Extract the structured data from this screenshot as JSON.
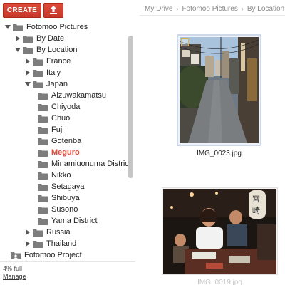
{
  "toolbar": {
    "create_label": "CREATE",
    "upload_icon": "upload-icon",
    "accent": "#dd4b39"
  },
  "breadcrumb": [
    "My Drive",
    "Fotomoo Pictures",
    "By Location"
  ],
  "tree": {
    "root": "Fotomoo Pictures",
    "by_date": "By Date",
    "by_location": "By Location",
    "countries": [
      "France",
      "Italy",
      "Japan"
    ],
    "japan_places": [
      "Aizuwakamatsu",
      "Chiyoda",
      "Chuo",
      "Fuji",
      "Gotenba",
      "Meguro",
      "Minamiuonuma District",
      "Nikko",
      "Setagaya",
      "Shibuya",
      "Susono",
      "Yama District"
    ],
    "active_place": "Meguro",
    "more_countries": [
      "Russia",
      "Thailand"
    ],
    "project": "Fotomoo Project",
    "active_color": "#dd4b39"
  },
  "storage": {
    "usage": "4% full",
    "manage_label": "Manage"
  },
  "files": [
    {
      "name": "IMG_0023.jpg"
    },
    {
      "name": "IMG_0019.jpg"
    }
  ]
}
